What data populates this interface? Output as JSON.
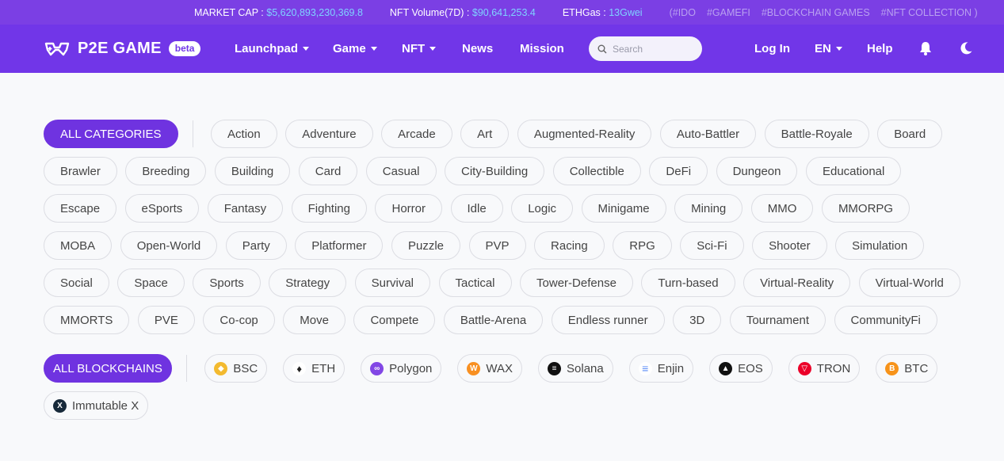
{
  "ticker": {
    "market_cap_label": "MARKET CAP :",
    "market_cap_value": "$5,620,893,230,369.8",
    "nft_volume_label": "NFT Volume(7D) :",
    "nft_volume_value": "$90,641,253.4",
    "eth_gas_label": "ETHGas :",
    "eth_gas_value": "13Gwei",
    "tags": [
      "(#IDO",
      "#GAMEFI",
      "#BLOCKCHAIN GAMES",
      "#NFT COLLECTION )"
    ]
  },
  "header": {
    "logo_text": "P2E GAME",
    "beta": "beta",
    "nav": [
      "Launchpad",
      "Game",
      "NFT",
      "News",
      "Mission"
    ],
    "search_placeholder": "Search",
    "login": "Log In",
    "lang": "EN",
    "help": "Help"
  },
  "categories": {
    "all_label": "ALL CATEGORIES",
    "rows": [
      [
        "Action",
        "Adventure",
        "Arcade",
        "Art",
        "Augmented-Reality",
        "Auto-Battler",
        "Battle-Royale",
        "Board"
      ],
      [
        "Brawler",
        "Breeding",
        "Building",
        "Card",
        "Casual",
        "City-Building",
        "Collectible",
        "DeFi",
        "Dungeon",
        "Educational"
      ],
      [
        "Escape",
        "eSports",
        "Fantasy",
        "Fighting",
        "Horror",
        "Idle",
        "Logic",
        "Minigame",
        "Mining",
        "MMO",
        "MMORPG"
      ],
      [
        "MOBA",
        "Open-World",
        "Party",
        "Platformer",
        "Puzzle",
        "PVP",
        "Racing",
        "RPG",
        "Sci-Fi",
        "Shooter",
        "Simulation"
      ],
      [
        "Social",
        "Space",
        "Sports",
        "Strategy",
        "Survival",
        "Tactical",
        "Tower-Defense",
        "Turn-based",
        "Virtual-Reality",
        "Virtual-World"
      ],
      [
        "MMORTS",
        "PVE",
        "Co-cop",
        "Move",
        "Compete",
        "Battle-Arena",
        "Endless runner",
        "3D",
        "Tournament",
        "CommunityFi"
      ]
    ]
  },
  "blockchains": {
    "all_label": "ALL BLOCKCHAINS",
    "rows": [
      [
        {
          "label": "BSC",
          "icon": "bsc-icon",
          "color": "#f3ba2f"
        },
        {
          "label": "ETH",
          "icon": "eth-icon",
          "color": "#ffffff"
        },
        {
          "label": "Polygon",
          "icon": "polygon-icon",
          "color": "#8247e5"
        },
        {
          "label": "WAX",
          "icon": "wax-icon",
          "color": "#f89022"
        },
        {
          "label": "Solana",
          "icon": "solana-icon",
          "color": "#111111"
        },
        {
          "label": "Enjin",
          "icon": "enjin-icon",
          "color": "#5b8cf7"
        },
        {
          "label": "EOS",
          "icon": "eos-icon",
          "color": "#111111"
        },
        {
          "label": "TRON",
          "icon": "tron-icon",
          "color": "#eb0029"
        },
        {
          "label": "BTC",
          "icon": "btc-icon",
          "color": "#f7931a"
        }
      ],
      [
        {
          "label": "Immutable X",
          "icon": "immutable-x-icon",
          "color": "#17293a"
        }
      ]
    ]
  },
  "colors": {
    "brand": "#7136e8",
    "ticker_bg": "#7b3fe4",
    "ticker_value": "#7fd3ff",
    "active_chip": "#6f33e0"
  }
}
